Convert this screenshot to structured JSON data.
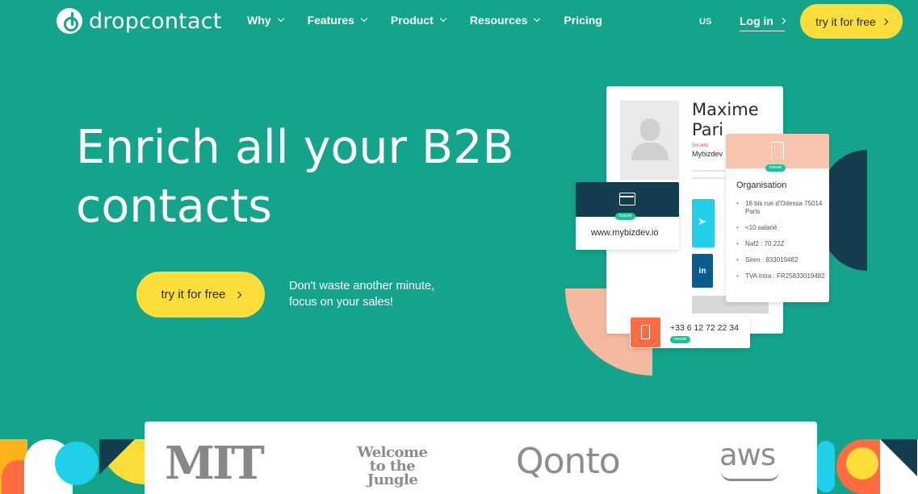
{
  "nav": {
    "logo_text": "dropcontact",
    "menu": [
      {
        "label": "Why",
        "has_dropdown": true
      },
      {
        "label": "Features",
        "has_dropdown": true
      },
      {
        "label": "Product",
        "has_dropdown": true
      },
      {
        "label": "Resources",
        "has_dropdown": true
      },
      {
        "label": "Pricing",
        "has_dropdown": false
      }
    ],
    "lang": "US",
    "login": "Log in",
    "cta": "try it for free"
  },
  "hero": {
    "title_line1": "Enrich all your B2B",
    "title_line2": "contacts",
    "cta": "try it for free",
    "sub_line1": "Don't waste another minute,",
    "sub_line2": "focus on your sales!"
  },
  "illustration": {
    "name_line1": "Maxime",
    "name_line2": "Pari",
    "company_label": "Société",
    "company_value": "Mybizdev",
    "website": "www.mybizdev.io",
    "found_badge": "trouvé",
    "linkedin": "in",
    "org_title": "Organisation",
    "org_items": [
      "16 bis rue d'Odessa 75014 Paris",
      "<10 salarié",
      "Naf2 : 70.22Z",
      "Siren : 833019482",
      "TVA intra : FR25833019482"
    ],
    "phone": "+33 6 12 72 22 34"
  },
  "logos": {
    "mit": "MIT",
    "wttj_line1": "Welcome",
    "wttj_line2": "to the Jungle",
    "qonto": "Qonto",
    "aws": "aws"
  },
  "colors": {
    "background": "#14a38b",
    "cta_yellow": "#fddd3a",
    "navy": "#143d4f",
    "cyan": "#1fd0e8",
    "orange": "#ff6c3f",
    "peach": "#f7c4ad"
  }
}
